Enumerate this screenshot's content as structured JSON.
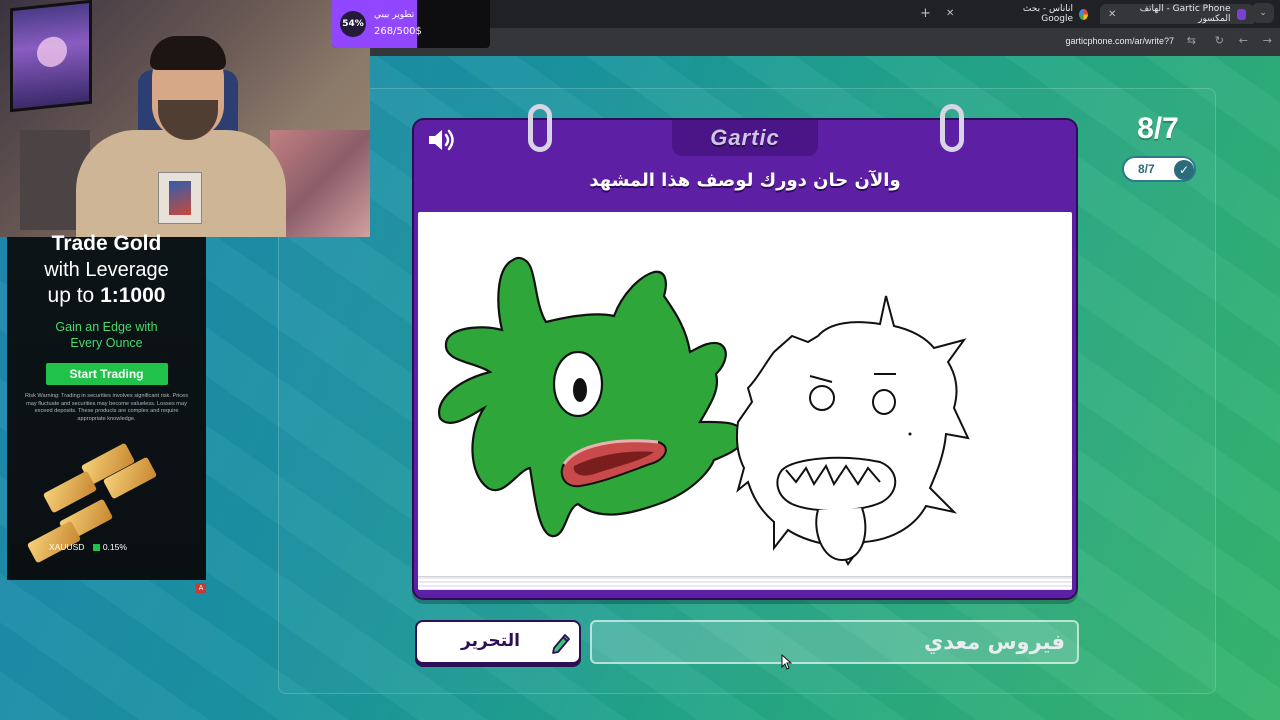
{
  "browser": {
    "tabs": [
      {
        "label": "Gartic Phone - الهاتف المكسور",
        "active": true
      },
      {
        "label": "اناناس - بحث Google",
        "active": false
      }
    ],
    "url": "garticphone.com/ar/write?7"
  },
  "overlay": {
    "sub_goal": {
      "percent": "54%",
      "percent_value": 0.54,
      "title": "تطوير بيبي",
      "count": "268/500$"
    },
    "ad": {
      "line1": "Trade Gold",
      "line2": "with Leverage",
      "line3_prefix": "up to ",
      "line3_bold": "1:1000",
      "subtitle_1": "Gain an Edge with",
      "subtitle_2": "Every Ounce",
      "cta": "Start Trading",
      "risk": "Risk Warning: Trading in securities involves significant risk. Prices may fluctuate and securities may become valueless. Losses may exceed deposits. These products are complex and require appropriate knowledge.",
      "ticker_symbol": "XAUUSD",
      "ticker_change": "0.15%",
      "badge": "A"
    }
  },
  "game": {
    "logo": "Gartic",
    "prompt": "والآن حان دورك لوصف هذا المشهد",
    "round_big": "8/7",
    "round_small": "8/7",
    "edit_button": "التحرير",
    "answer_value": "فيروس معدي"
  },
  "colors": {
    "panel_purple": "#5d1fa3",
    "panel_dark": "#2d0d57",
    "monster_green": "#2ea63a",
    "accent_sub": "#9147ff"
  },
  "icons": {
    "speaker": "speaker-icon",
    "pencil": "pencil-icon",
    "check": "check-icon",
    "close": "close-icon",
    "new_tab": "plus-icon",
    "reload": "reload-icon"
  }
}
